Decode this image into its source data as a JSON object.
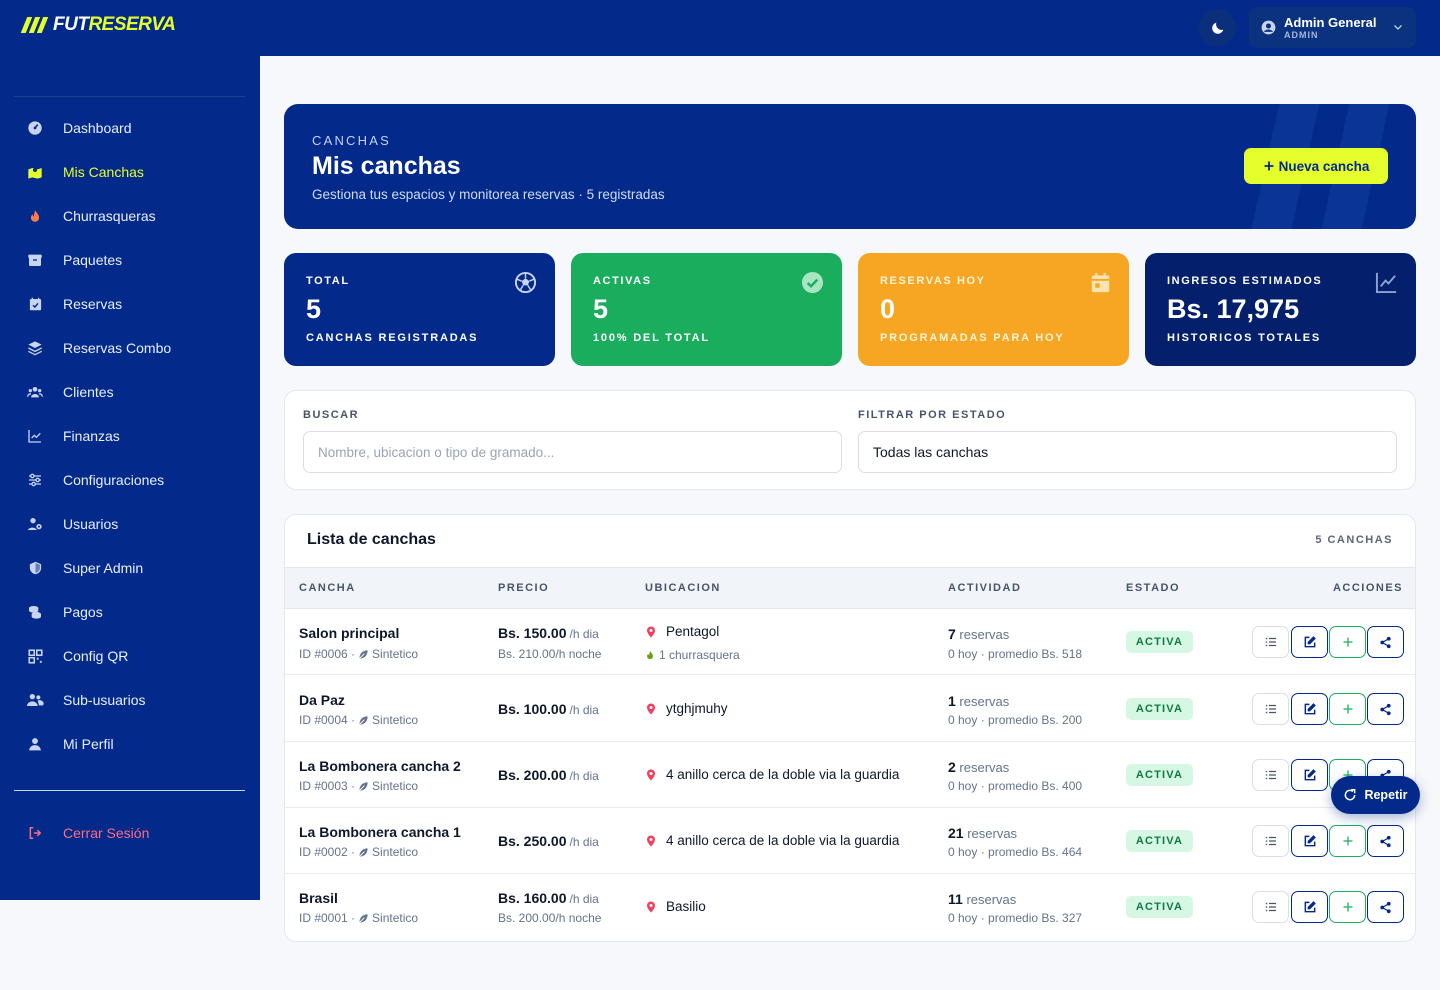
{
  "brand": {
    "part1": "FUT",
    "part2": "RESERVA"
  },
  "user": {
    "name": "Admin General",
    "role": "ADMIN"
  },
  "sidebar": {
    "items": [
      {
        "label": "Dashboard",
        "icon": "gauge-icon"
      },
      {
        "label": "Mis Canchas",
        "icon": "map-icon",
        "active": true
      },
      {
        "label": "Churrasqueras",
        "icon": "fire-icon"
      },
      {
        "label": "Paquetes",
        "icon": "box-icon"
      },
      {
        "label": "Reservas",
        "icon": "calendar-check-icon"
      },
      {
        "label": "Reservas Combo",
        "icon": "layers-icon"
      },
      {
        "label": "Clientes",
        "icon": "users-icon"
      },
      {
        "label": "Finanzas",
        "icon": "chart-line-icon"
      },
      {
        "label": "Configuraciones",
        "icon": "sliders-icon"
      },
      {
        "label": "Usuarios",
        "icon": "user-gear-icon"
      },
      {
        "label": "Super Admin",
        "icon": "shield-icon"
      },
      {
        "label": "Pagos",
        "icon": "coins-icon"
      },
      {
        "label": "Config QR",
        "icon": "qr-icon"
      },
      {
        "label": "Sub-usuarios",
        "icon": "user-group-icon"
      },
      {
        "label": "Mi Perfil",
        "icon": "user-icon"
      }
    ],
    "logout": "Cerrar Sesión"
  },
  "hero": {
    "kicker": "CANCHAS",
    "title": "Mis canchas",
    "subtitle": "Gestiona tus espacios y monitorea reservas · 5 registradas",
    "new_button": "Nueva cancha"
  },
  "stats": [
    {
      "label": "TOTAL",
      "value": "5",
      "desc": "CANCHAS REGISTRADAS",
      "icon": "soccer-ball-icon"
    },
    {
      "label": "ACTIVAS",
      "value": "5",
      "desc": "100% DEL TOTAL",
      "icon": "check-circle-icon"
    },
    {
      "label": "RESERVAS HOY",
      "value": "0",
      "desc": "PROGRAMADAS PARA HOY",
      "icon": "calendar-icon"
    },
    {
      "label": "INGRESOS ESTIMADOS",
      "value": "Bs. 17,975",
      "desc": "HISTORICOS TOTALES",
      "icon": "trend-icon"
    }
  ],
  "filters": {
    "search_label": "BUSCAR",
    "search_placeholder": "Nombre, ubicacion o tipo de gramado...",
    "status_label": "FILTRAR POR ESTADO",
    "status_value": "Todas las canchas"
  },
  "list": {
    "title": "Lista de canchas",
    "count": "5 CANCHAS",
    "columns": [
      "CANCHA",
      "PRECIO",
      "UBICACION",
      "ACTIVIDAD",
      "ESTADO",
      "ACCIONES"
    ],
    "rows": [
      {
        "name": "Salon principal",
        "id": "ID #0006 ·",
        "surface": "Sintetico",
        "price": "Bs. 150.00",
        "price_unit": "/h dia",
        "night": "Bs. 210.00/h noche",
        "location": "Pentagol",
        "churr": "1 churrasquera",
        "res_count": "7",
        "res_word": "reservas",
        "activity": "0 hoy · promedio Bs. 518",
        "status": "ACTIVA"
      },
      {
        "name": "Da Paz",
        "id": "ID #0004 ·",
        "surface": "Sintetico",
        "price": "Bs. 100.00",
        "price_unit": "/h dia",
        "night": "",
        "location": "ytghjmuhy",
        "churr": "",
        "res_count": "1",
        "res_word": "reservas",
        "activity": "0 hoy · promedio Bs. 200",
        "status": "ACTIVA"
      },
      {
        "name": "La Bombonera cancha 2",
        "id": "ID #0003 ·",
        "surface": "Sintetico",
        "price": "Bs. 200.00",
        "price_unit": "/h dia",
        "night": "",
        "location": "4 anillo cerca de la doble via la guardia",
        "churr": "",
        "res_count": "2",
        "res_word": "reservas",
        "activity": "0 hoy · promedio Bs. 400",
        "status": "ACTIVA"
      },
      {
        "name": "La Bombonera cancha 1",
        "id": "ID #0002 ·",
        "surface": "Sintetico",
        "price": "Bs. 250.00",
        "price_unit": "/h dia",
        "night": "",
        "location": "4 anillo cerca de la doble via la guardia",
        "churr": "",
        "res_count": "21",
        "res_word": "reservas",
        "activity": "0 hoy · promedio Bs. 464",
        "status": "ACTIVA"
      },
      {
        "name": "Brasil",
        "id": "ID #0001 ·",
        "surface": "Sintetico",
        "price": "Bs. 160.00",
        "price_unit": "/h dia",
        "night": "Bs. 200.00/h noche",
        "location": "Basilio",
        "churr": "",
        "res_count": "11",
        "res_word": "reservas",
        "activity": "0 hoy · promedio Bs. 327",
        "status": "ACTIVA"
      }
    ]
  },
  "repeat_button": "Repetir",
  "colors": {
    "primary": "#032a8a",
    "accent": "#e4ff2b",
    "success": "#1aad5e",
    "warning": "#f6a623",
    "danger": "#ff6b81"
  }
}
